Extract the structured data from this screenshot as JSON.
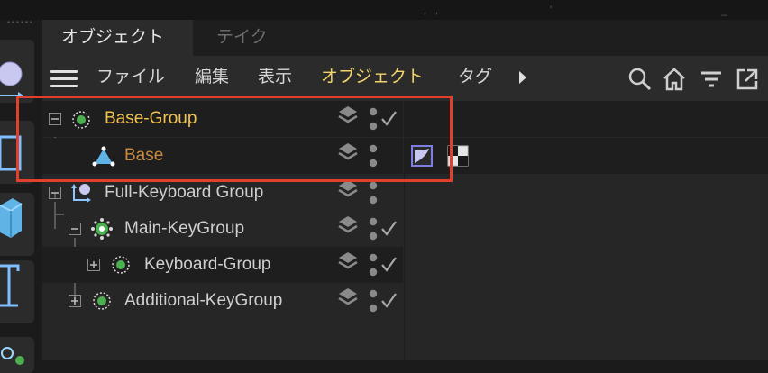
{
  "tabs": [
    {
      "label": "オブジェクト",
      "active": true
    },
    {
      "label": "テイク",
      "active": false
    }
  ],
  "menu": {
    "items": [
      {
        "label": "ファイル"
      },
      {
        "label": "編集"
      },
      {
        "label": "表示"
      },
      {
        "label": "オブジェクト",
        "highlight": true
      },
      {
        "label": "タグ"
      }
    ],
    "right_icons": [
      "search-icon",
      "home-icon",
      "filter-icon",
      "external-window-icon"
    ]
  },
  "tree": [
    {
      "name": "Base-Group",
      "icon": "null-object-icon",
      "expand": "minus",
      "color": "#f0c24f",
      "selected": true
    },
    {
      "name": "Base",
      "icon": "polygon-object-icon",
      "expand": "none",
      "color": "#c98a3f",
      "selected": true
    },
    {
      "name": "Full-Keyboard Group",
      "icon": "connector-object-icon",
      "expand": "minus",
      "color": "#cfcfcf",
      "selected": false
    },
    {
      "name": "Main-KeyGroup",
      "icon": "cloner-icon",
      "expand": "minus",
      "color": "#cfcfcf",
      "selected": false
    },
    {
      "name": "Keyboard-Group",
      "icon": "null-object-icon",
      "expand": "plus",
      "color": "#cfcfcf",
      "selected": false
    },
    {
      "name": "Additional-KeyGroup",
      "icon": "null-object-icon",
      "expand": "plus",
      "color": "#cfcfcf",
      "selected": false
    }
  ],
  "tag_icons": [
    "phong-tag-icon",
    "material-tag-icon"
  ],
  "colors": {
    "accent": "#f2d46a",
    "annotation": "#e0402c",
    "green": "#4caf50"
  }
}
